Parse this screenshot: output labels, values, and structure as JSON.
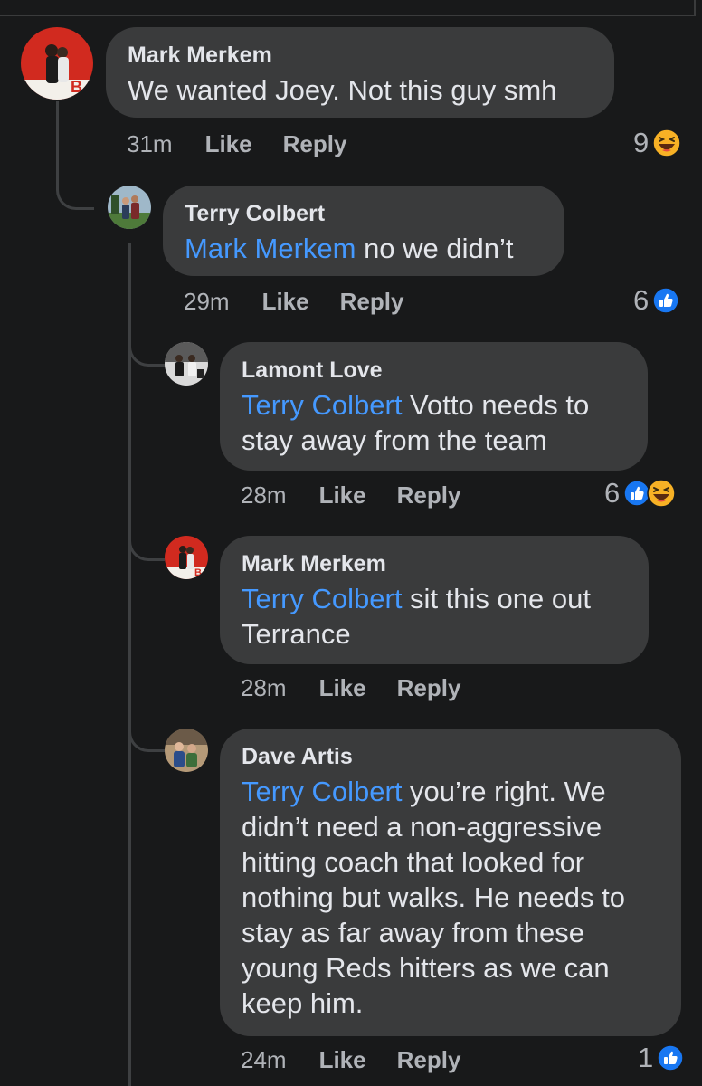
{
  "comments": [
    {
      "author": "Mark Merkem",
      "text": "We wanted Joey. Not this guy smh",
      "time": "31m",
      "like_label": "Like",
      "reply_label": "Reply",
      "reaction_count": "9",
      "reactions": [
        "haha-icon"
      ]
    },
    {
      "author": "Terry Colbert",
      "mention": "Mark Merkem",
      "text": " no we didn’t",
      "time": "29m",
      "like_label": "Like",
      "reply_label": "Reply",
      "reaction_count": "6",
      "reactions": [
        "like-icon"
      ]
    },
    {
      "author": "Lamont Love",
      "mention": "Terry Colbert",
      "text": " Votto needs to stay away from the team",
      "time": "28m",
      "like_label": "Like",
      "reply_label": "Reply",
      "reaction_count": "6",
      "reactions": [
        "like-icon",
        "haha-icon"
      ]
    },
    {
      "author": "Mark Merkem",
      "mention": "Terry Colbert",
      "text": " sit this one out Terrance",
      "time": "28m",
      "like_label": "Like",
      "reply_label": "Reply"
    },
    {
      "author": "Dave Artis",
      "mention": "Terry Colbert",
      "text": " you’re right. We didn’t need a non-aggressive hitting coach that looked for nothing but walks. He needs to stay as far away from these young Reds hitters as we can keep him.",
      "time": "24m",
      "like_label": "Like",
      "reply_label": "Reply",
      "reaction_count": "1",
      "reactions": [
        "like-icon"
      ]
    }
  ],
  "colors": {
    "background": "#18191a",
    "bubble": "#3a3b3c",
    "mention": "#4599ff",
    "meta": "#b0b3b8",
    "like_blue": "#1877f2",
    "haha_yellow": "#f7b125"
  }
}
